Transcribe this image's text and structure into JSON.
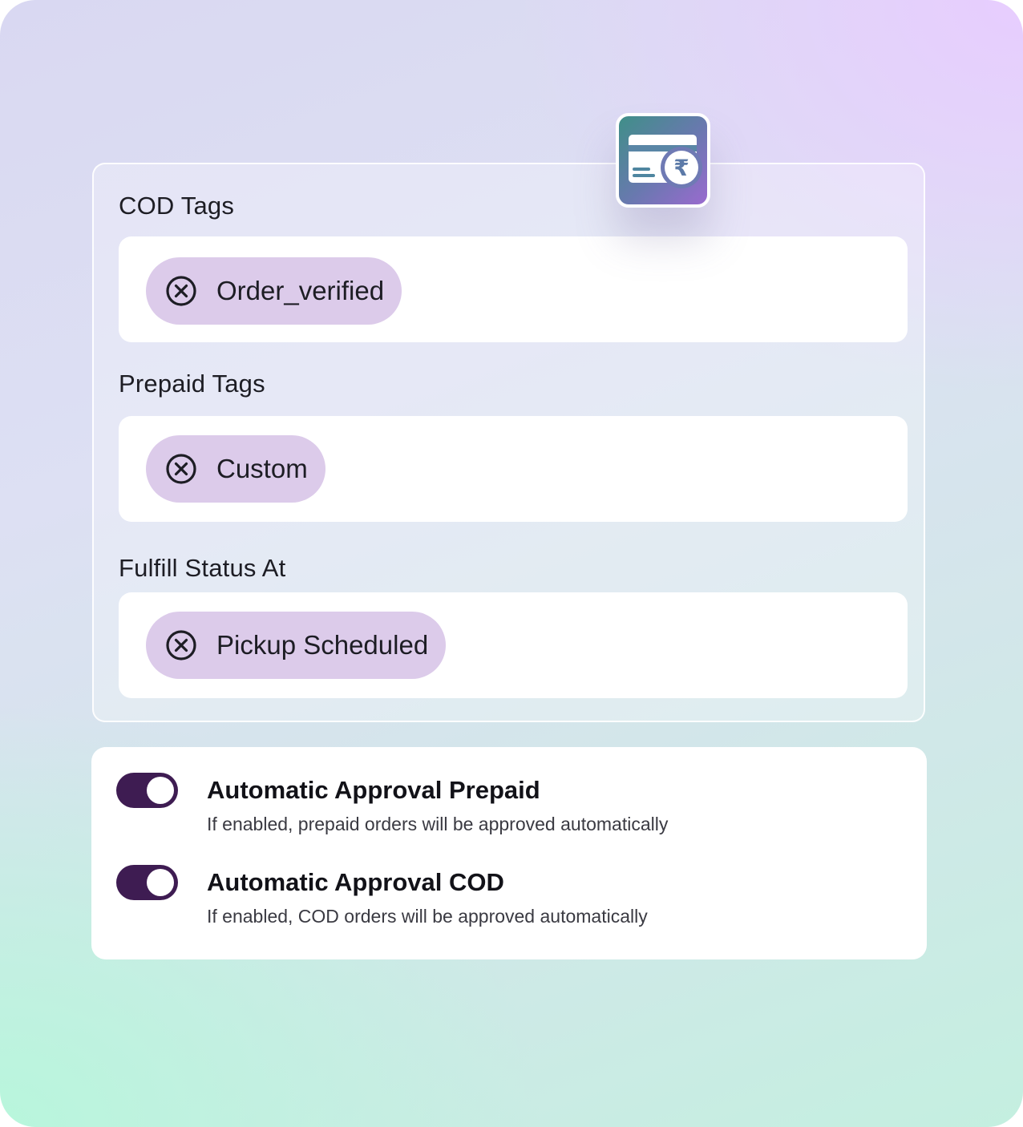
{
  "colors": {
    "chip_bg": "#dccbea",
    "toggle_on": "#3e1c52",
    "badge_gradient_start": "#3f8f88",
    "badge_gradient_end": "#9a6acf"
  },
  "badge": {
    "icon": "card-rupee-icon"
  },
  "fields": [
    {
      "label": "COD Tags",
      "chips": [
        "Order_verified"
      ]
    },
    {
      "label": "Prepaid Tags",
      "chips": [
        "Custom"
      ]
    },
    {
      "label": "Fulfill Status At",
      "chips": [
        "Pickup Scheduled"
      ]
    }
  ],
  "toggles": [
    {
      "title": "Automatic Approval Prepaid",
      "description": "If enabled, prepaid orders will be approved automatically",
      "enabled": true
    },
    {
      "title": "Automatic Approval COD",
      "description": "If enabled, COD orders will be approved automatically",
      "enabled": true
    }
  ]
}
